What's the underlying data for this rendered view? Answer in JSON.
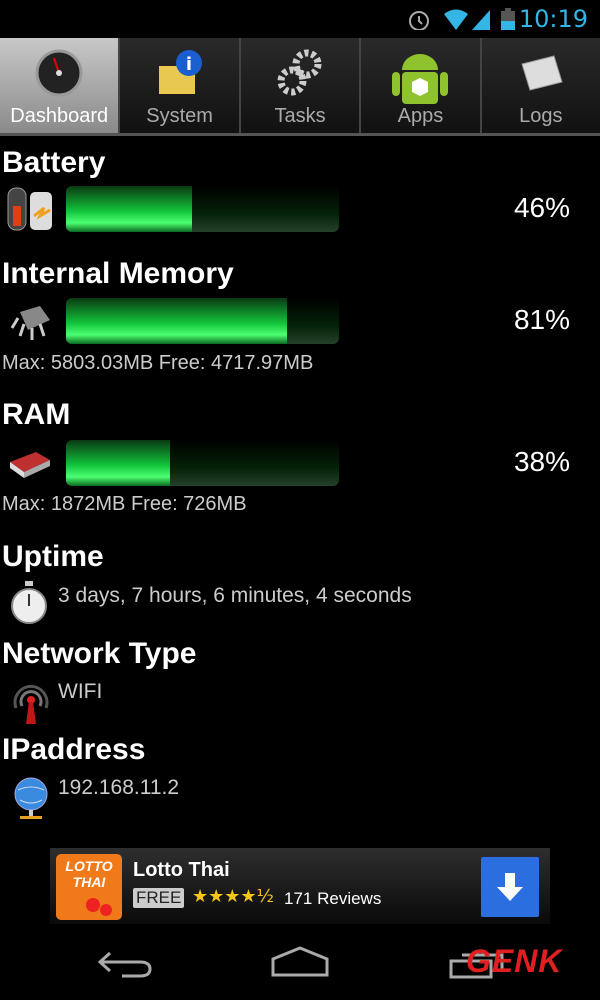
{
  "status_bar": {
    "time": "10:19",
    "icons": [
      "alarm-icon",
      "wifi-icon",
      "signal-icon",
      "battery-icon"
    ]
  },
  "tabs": [
    {
      "label": "Dashboard",
      "icon": "dashboard-gauge-icon",
      "active": true
    },
    {
      "label": "System",
      "icon": "system-info-icon"
    },
    {
      "label": "Tasks",
      "icon": "gears-icon"
    },
    {
      "label": "Apps",
      "icon": "android-icon"
    },
    {
      "label": "Logs",
      "icon": "newspaper-icon"
    }
  ],
  "battery": {
    "title": "Battery",
    "percent_label": "46%",
    "percent": 46
  },
  "internal_memory": {
    "title": "Internal Memory",
    "percent_label": "81%",
    "percent": 81,
    "detail": "Max: 5803.03MB Free: 4717.97MB"
  },
  "ram": {
    "title": "RAM",
    "percent_label": "38%",
    "percent": 38,
    "detail": "Max: 1872MB Free: 726MB"
  },
  "uptime": {
    "title": "Uptime",
    "value": "3 days, 7 hours, 6 minutes, 4 seconds"
  },
  "network": {
    "title": "Network Type",
    "value": "WIFI"
  },
  "ip": {
    "title": "IPaddress",
    "value": "192.168.11.2"
  },
  "ad": {
    "app_name": "Lotto Thai",
    "price": "FREE",
    "rating": 4.5,
    "stars": "★★★★½",
    "reviews": "171 Reviews",
    "icon_text": "LOTTO THAI"
  },
  "watermark": "GENK",
  "accent": "#33b5e5",
  "bar_color": "#12c43a"
}
